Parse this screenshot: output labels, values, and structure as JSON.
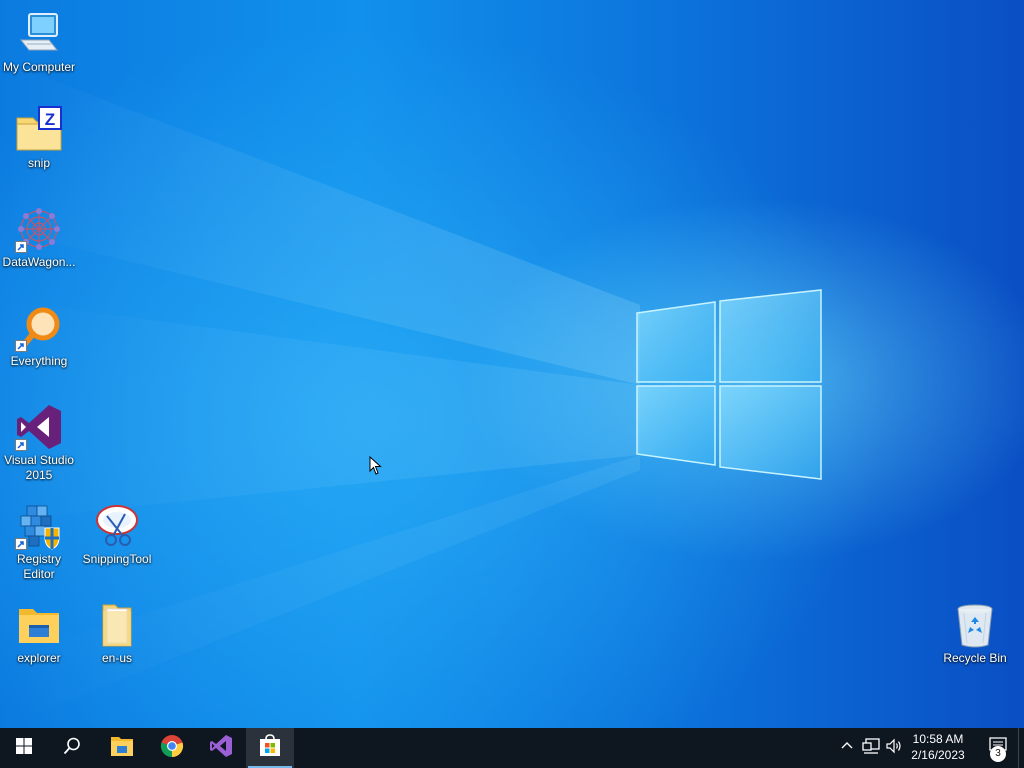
{
  "desktop": {
    "icons": [
      {
        "label": "My Computer",
        "icon": "computer-icon"
      },
      {
        "label": "snip",
        "icon": "folder-z-icon"
      },
      {
        "label": "DataWagon...",
        "icon": "datawagon-icon"
      },
      {
        "label": "Everything",
        "icon": "everything-search-icon"
      },
      {
        "label": "Visual Studio 2015",
        "icon": "visual-studio-icon"
      },
      {
        "label": "Registry Editor",
        "icon": "registry-editor-icon"
      },
      {
        "label": "SnippingTool",
        "icon": "snipping-tool-icon"
      },
      {
        "label": "explorer",
        "icon": "file-explorer-icon"
      },
      {
        "label": "en-us",
        "icon": "folder-document-icon"
      },
      {
        "label": "Recycle Bin",
        "icon": "recycle-bin-icon"
      }
    ]
  },
  "taskbar": {
    "pinned": [
      {
        "name": "start",
        "icon": "windows-start-icon"
      },
      {
        "name": "search",
        "icon": "search-icon"
      },
      {
        "name": "file-explorer",
        "icon": "file-explorer-icon"
      },
      {
        "name": "chrome",
        "icon": "chrome-icon"
      },
      {
        "name": "visual-studio",
        "icon": "visual-studio-icon"
      },
      {
        "name": "store",
        "icon": "microsoft-store-icon",
        "active": true
      }
    ],
    "tray": {
      "icons": [
        "chevron-up-icon",
        "network-icon",
        "volume-icon"
      ],
      "time": "10:58 AM",
      "date": "2/16/2023",
      "notification_count": "3"
    }
  },
  "colors": {
    "taskbar": "#0e1620",
    "accent": "#76b9ed",
    "desktop_blue": "#0b7be0"
  }
}
